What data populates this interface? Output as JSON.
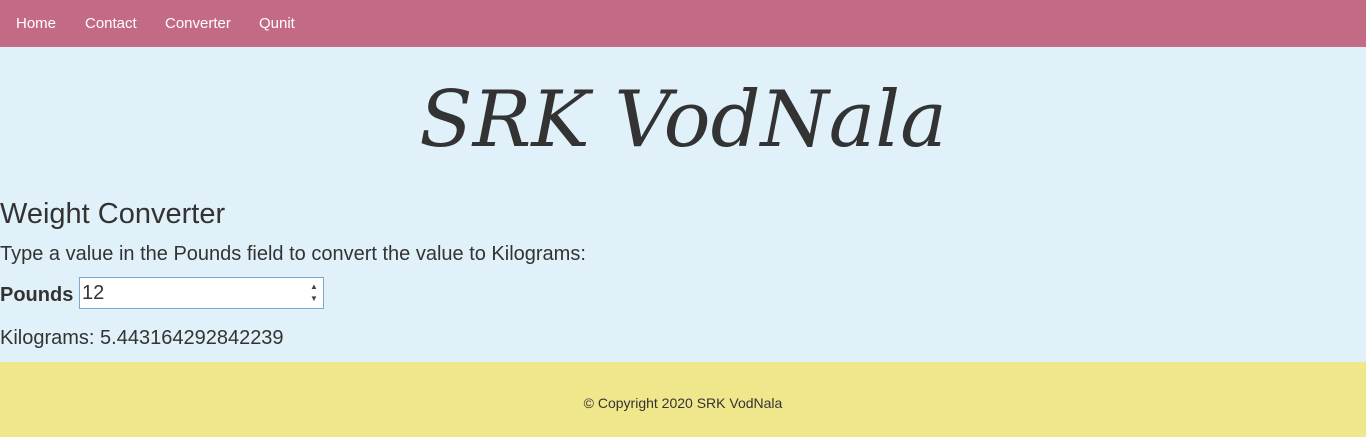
{
  "nav": {
    "items": [
      {
        "label": "Home"
      },
      {
        "label": "Contact"
      },
      {
        "label": "Converter"
      },
      {
        "label": "Qunit"
      }
    ]
  },
  "header": {
    "brand": "SRK VodNala"
  },
  "converter": {
    "title": "Weight Converter",
    "instructions": "Type a value in the Pounds field to convert the value to Kilograms:",
    "pounds_label": "Pounds",
    "pounds_value": "12",
    "result_label": "Kilograms: ",
    "result_value": "5.443164292842239"
  },
  "footer": {
    "copyright": "© Copyright 2020 SRK VodNala"
  },
  "colors": {
    "navbar": "#c36b84",
    "main_background": "#e0f1fa",
    "footer_background": "#f0e68c"
  }
}
